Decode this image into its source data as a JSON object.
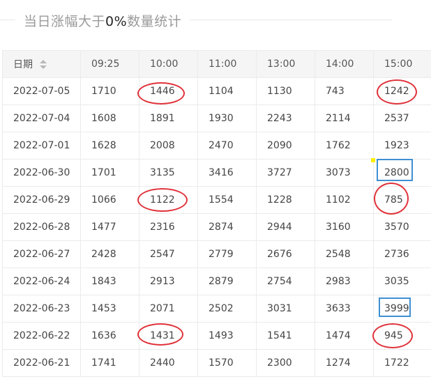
{
  "title": {
    "prefix": "当日涨幅大于",
    "highlight": "0%",
    "suffix": "数量统计"
  },
  "table": {
    "headers": [
      "日期",
      "09:25",
      "10:00",
      "11:00",
      "13:00",
      "14:00",
      "15:00"
    ],
    "rows": [
      [
        "2022-07-05",
        "1710",
        "1446",
        "1104",
        "1130",
        "743",
        "1242"
      ],
      [
        "2022-07-04",
        "1608",
        "1891",
        "1930",
        "2243",
        "2114",
        "2537"
      ],
      [
        "2022-07-01",
        "1628",
        "2008",
        "2470",
        "2090",
        "1762",
        "1923"
      ],
      [
        "2022-06-30",
        "1701",
        "3135",
        "3416",
        "3727",
        "3073",
        "2800"
      ],
      [
        "2022-06-29",
        "1066",
        "1122",
        "1554",
        "1228",
        "1102",
        "785"
      ],
      [
        "2022-06-28",
        "1477",
        "2316",
        "2874",
        "2944",
        "3160",
        "3570"
      ],
      [
        "2022-06-27",
        "2428",
        "2547",
        "2779",
        "2676",
        "2548",
        "2736"
      ],
      [
        "2022-06-24",
        "1843",
        "2913",
        "2879",
        "2754",
        "2983",
        "3035"
      ],
      [
        "2022-06-23",
        "1453",
        "2071",
        "2502",
        "3031",
        "3633",
        "3999"
      ],
      [
        "2022-06-22",
        "1636",
        "1431",
        "1493",
        "1541",
        "1474",
        "945"
      ],
      [
        "2022-06-21",
        "1741",
        "2440",
        "1570",
        "2300",
        "1274",
        "1722"
      ]
    ]
  },
  "annotations": {
    "circle_color": "#e0323a",
    "box_color": "#3f8fd2"
  }
}
